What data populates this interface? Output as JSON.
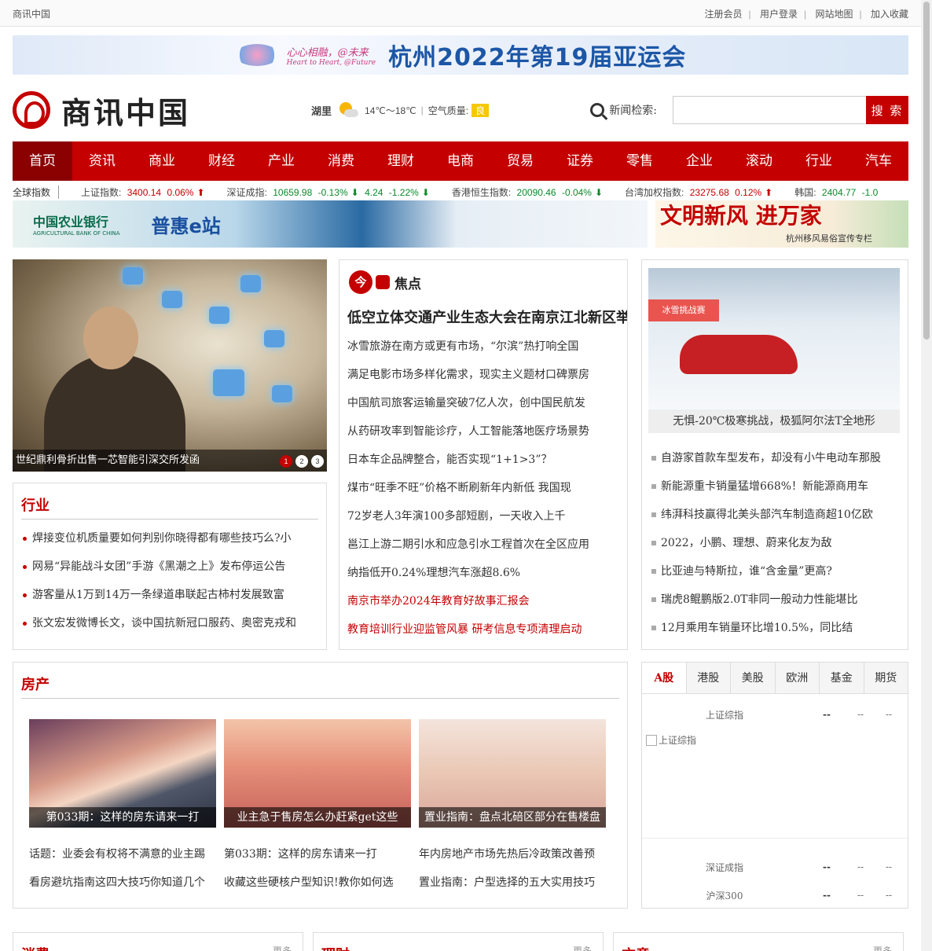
{
  "topbar": {
    "site_name": "商讯中国",
    "links": [
      "注册会员",
      "用户登录",
      "网站地图",
      "加入收藏"
    ]
  },
  "banner": {
    "slogan": "心心相融，@未来",
    "slogan_en": "Heart to Heart, @Future",
    "title": "杭州2022年第19届亚运会"
  },
  "header": {
    "logo_text": "商讯中国",
    "weather": {
      "city": "湖里",
      "temp": "14℃～18℃",
      "aqi_label": "空气质量:",
      "aqi_value": "良"
    },
    "search": {
      "label": "新闻检索:",
      "placeholder": "",
      "button": "搜 索"
    }
  },
  "nav": [
    "首页",
    "资讯",
    "商业",
    "财经",
    "产业",
    "消费",
    "理财",
    "电商",
    "贸易",
    "证券",
    "零售",
    "企业",
    "滚动",
    "行业",
    "汽车"
  ],
  "ticker": {
    "label": "全球指数",
    "items": [
      {
        "name": "上证指数:",
        "value": "3400.14",
        "change": "0.06%",
        "dir": "up"
      },
      {
        "name": "深证成指:",
        "value": "10659.98",
        "change": "-0.13%",
        "dir": "down"
      },
      {
        "name": "",
        "value": "4.24",
        "change": "-1.22%",
        "dir": "down"
      },
      {
        "name": "香港恒生指数:",
        "value": "20090.46",
        "change": "-0.04%",
        "dir": "down"
      },
      {
        "name": "台湾加权指数:",
        "value": "23275.68",
        "change": "0.12%",
        "dir": "up"
      },
      {
        "name": "韩国:",
        "value": "2404.77",
        "change": "-1.0",
        "dir": "down"
      }
    ]
  },
  "ads": {
    "ad1_bank": "中国农业银行",
    "ad1_bank_en": "AGRICULTURAL BANK OF CHINA",
    "ad1_brand": "普惠e站",
    "ad2_title": "文明新风 进万家",
    "ad2_sub": "杭州移风易俗宣传专栏"
  },
  "slider": {
    "caption": "世纪鼎利骨折出售一芯智能引深交所发函",
    "pages": [
      "1",
      "2",
      "3"
    ]
  },
  "industry": {
    "title": "行业",
    "items": [
      "焊接变位机质量要如何判别你晓得都有哪些技巧么?小",
      "网易“异能战斗女团”手游《黑潮之上》发布停运公告",
      "游客量从1万到14万一条绿道串联起古柿村发展致富",
      "张文宏发微博长文，谈中国抗新冠口服药、奥密克戎和"
    ]
  },
  "focus": {
    "title": "焦点",
    "badge": "今",
    "headline": "低空立体交通产业生态大会在南京江北新区举",
    "items": [
      "冰雪旅游在南方或更有市场，“尔滨”热打响全国",
      "满足电影市场多样化需求，现实主义题材口碑票房",
      "中国航司旅客运输量突破7亿人次，创中国民航发",
      "从药研攻率到智能诊疗，人工智能落地医疗场景势",
      "日本车企品牌整合，能否实现“1+1>3”？",
      "煤市“旺季不旺”价格不断刷新年内新低 我国现",
      "72岁老人3年演100多部短剧，一天收入上千",
      "邕江上游二期引水和应急引水工程首次在全区应用",
      "纳指低开0.24%理想汽车涨超8.6%"
    ],
    "red_items": [
      "南京市举办2024年教育好故事汇报会",
      "教育培训行业迎监管风暴 研考信息专项清理启动"
    ]
  },
  "right_news": {
    "image_caption": "无惧-20℃极寒挑战，极狐阿尔法T全地形",
    "image_banner": "冰雪挑战赛",
    "items": [
      "自游家首款车型发布，却没有小牛电动车那股",
      "新能源重卡销量猛增668%！新能源商用车",
      "纬湃科技赢得北美头部汽车制造商超10亿欧",
      "2022，小鹏、理想、蔚来化友为敌",
      "比亚迪与特斯拉，谁“含金量”更高?",
      "瑞虎8鲲鹏版2.0T非同一般动力性能堪比",
      "12月乘用车销量环比增10.5%，同比结"
    ]
  },
  "house": {
    "title": "房产",
    "pics": [
      "第033期：这样的房东请来一打",
      "业主急于售房怎么办赶紧get这些",
      "置业指南：盘点北碚区部分在售楼盘"
    ],
    "links": [
      [
        "话题：业委会有权将不满意的业主踢",
        "看房避坑指南这四大技巧你知道几个"
      ],
      [
        "第033期：这样的房东请来一打",
        "收藏这些硬核户型知识!教你如何选"
      ],
      [
        "年内房地产市场先热后冷政策改善预",
        "置业指南：户型选择的五大实用技巧"
      ]
    ]
  },
  "stock": {
    "tabs": [
      "A股",
      "港股",
      "美股",
      "欧洲",
      "基金",
      "期货"
    ],
    "rows": [
      {
        "name": "上证综指",
        "value": "--",
        "c1": "--",
        "c2": "--"
      },
      {
        "name": "深证成指",
        "value": "--",
        "c1": "--",
        "c2": "--"
      },
      {
        "name": "沪深300",
        "value": "--",
        "c1": "--",
        "c2": "--"
      }
    ],
    "chart_alt": "上证综指"
  },
  "bottom": [
    {
      "title": "消费",
      "more": "更多"
    },
    {
      "title": "理财",
      "more": "更多"
    },
    {
      "title": "方意",
      "more": "更多"
    }
  ]
}
